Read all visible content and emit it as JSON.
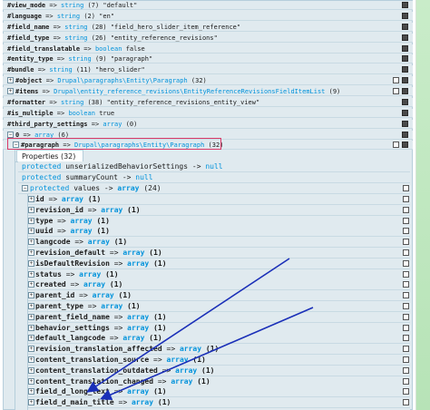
{
  "top_rows": [
    {
      "key": "#view_mode",
      "arrow": "=>",
      "type": "string",
      "value": "(7) \"default\""
    },
    {
      "key": "#language",
      "arrow": "=>",
      "type": "string",
      "value": "(2) \"en\""
    },
    {
      "key": "#field_name",
      "arrow": "=>",
      "type": "string",
      "value": "(28) \"field_hero_slider_item_reference\""
    },
    {
      "key": "#field_type",
      "arrow": "=>",
      "type": "string",
      "value": "(26) \"entity_reference_revisions\""
    },
    {
      "key": "#field_translatable",
      "arrow": "=>",
      "type": "boolean",
      "value": "false"
    },
    {
      "key": "#entity_type",
      "arrow": "=>",
      "type": "string",
      "value": "(9) \"paragraph\""
    },
    {
      "key": "#bundle",
      "arrow": "=>",
      "type": "string",
      "value": "(11) \"hero_slider\""
    },
    {
      "key": "#object",
      "arrow": "=>",
      "type": "Drupal\\paragraphs\\Entity\\Paragraph",
      "value": "(32)"
    },
    {
      "key": "#items",
      "arrow": "=>",
      "type": "Drupal\\entity_reference_revisions\\EntityReferenceRevisionsFieldItemList",
      "value": "(9)"
    },
    {
      "key": "#formatter",
      "arrow": "=>",
      "type": "string",
      "value": "(38) \"entity_reference_revisions_entity_view\""
    },
    {
      "key": "#is_multiple",
      "arrow": "=>",
      "type": "boolean",
      "value": "true"
    },
    {
      "key": "#third_party_settings",
      "arrow": "=>",
      "type": "array",
      "value": "(0)"
    },
    {
      "key": "0",
      "arrow": "=>",
      "type": "array",
      "value": "(6)"
    },
    {
      "key": "#paragraph",
      "arrow": "=>",
      "type": "Drupal\\paragraphs\\Entity\\Paragraph",
      "value": "(32)"
    }
  ],
  "properties_tab": "Properties (32)",
  "props": [
    {
      "kw": "protected",
      "name": "unserializedBehaviorSettings",
      "arrow": "->",
      "val": "null"
    },
    {
      "kw": "protected",
      "name": "summaryCount",
      "arrow": "->",
      "val": "null"
    },
    {
      "kw": "protected",
      "name": "values",
      "arrow": "->",
      "val": "array",
      "count": "(24)"
    }
  ],
  "value_rows": [
    {
      "key": "id",
      "type": "array",
      "count": "(1)"
    },
    {
      "key": "revision_id",
      "type": "array",
      "count": "(1)"
    },
    {
      "key": "type",
      "type": "array",
      "count": "(1)"
    },
    {
      "key": "uuid",
      "type": "array",
      "count": "(1)"
    },
    {
      "key": "langcode",
      "type": "array",
      "count": "(1)"
    },
    {
      "key": "revision_default",
      "type": "array",
      "count": "(1)"
    },
    {
      "key": "isDefaultRevision",
      "type": "array",
      "count": "(1)"
    },
    {
      "key": "status",
      "type": "array",
      "count": "(1)"
    },
    {
      "key": "created",
      "type": "array",
      "count": "(1)"
    },
    {
      "key": "parent_id",
      "type": "array",
      "count": "(1)"
    },
    {
      "key": "parent_type",
      "type": "array",
      "count": "(1)"
    },
    {
      "key": "parent_field_name",
      "type": "array",
      "count": "(1)"
    },
    {
      "key": "behavior_settings",
      "type": "array",
      "count": "(1)"
    },
    {
      "key": "default_langcode",
      "type": "array",
      "count": "(1)"
    },
    {
      "key": "revision_translation_affected",
      "type": "array",
      "count": "(1)"
    },
    {
      "key": "content_translation_source",
      "type": "array",
      "count": "(1)"
    },
    {
      "key": "content_translation_outdated",
      "type": "array",
      "count": "(1)"
    },
    {
      "key": "content_translation_changed",
      "type": "array",
      "count": "(1)"
    },
    {
      "key": "field_d_long_text",
      "type": "array",
      "count": "(1)"
    },
    {
      "key": "field_d_main_title",
      "type": "array",
      "count": "(1)"
    }
  ],
  "colors": {
    "type": "#0092db",
    "highlight": "#d93a68",
    "arrows": "#1a2fb8",
    "panel": "#e0eaef"
  }
}
